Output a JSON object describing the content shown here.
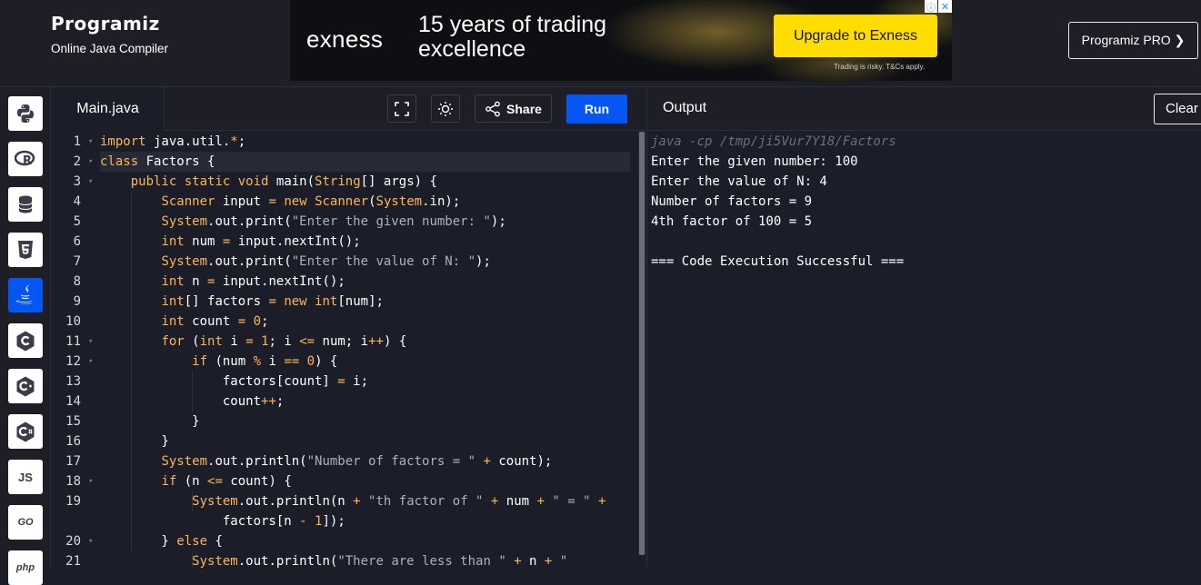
{
  "header": {
    "brand": "Programiz",
    "subtitle": "Online Java Compiler",
    "pro_button": "Programiz PRO ❯"
  },
  "ad": {
    "logo": "exness",
    "headline": "15 years of trading excellence",
    "cta": "Upgrade to Exness",
    "note": "Trading is risky. T&Cs apply.",
    "info_icon": "ⓘ",
    "close_icon": "✕"
  },
  "languages": [
    {
      "name": "Python",
      "icon": "python-icon"
    },
    {
      "name": "R",
      "icon": "r-icon"
    },
    {
      "name": "SQL",
      "icon": "database-icon"
    },
    {
      "name": "HTML",
      "icon": "html5-icon"
    },
    {
      "name": "Java",
      "icon": "java-icon",
      "active": true
    },
    {
      "name": "C",
      "icon": "c-icon"
    },
    {
      "name": "C++",
      "icon": "cpp-icon"
    },
    {
      "name": "C#",
      "icon": "csharp-icon"
    },
    {
      "name": "JS",
      "icon": "js-icon",
      "label": "JS"
    },
    {
      "name": "Go",
      "icon": "go-icon",
      "label": "GO"
    },
    {
      "name": "PHP",
      "icon": "php-icon",
      "label": "php"
    }
  ],
  "editor": {
    "tab": "Main.java",
    "share_label": "Share",
    "run_label": "Run",
    "line_numbers": [
      "1",
      "2",
      "3",
      "4",
      "5",
      "6",
      "7",
      "8",
      "9",
      "10",
      "11",
      "12",
      "13",
      "14",
      "15",
      "16",
      "17",
      "18",
      "19",
      "",
      "20",
      "21"
    ],
    "lines": [
      "import java.util.*;",
      "class Factors {",
      "    public static void main(String[] args) {",
      "        Scanner input = new Scanner(System.in);",
      "        System.out.print(\"Enter the given number: \");",
      "        int num = input.nextInt();",
      "        System.out.print(\"Enter the value of N: \");",
      "        int n = input.nextInt();",
      "        int[] factors = new int[num];",
      "        int count = 0;",
      "        for (int i = 1; i <= num; i++) {",
      "            if (num % i == 0) {",
      "                factors[count] = i;",
      "                count++;",
      "            }",
      "        }",
      "        System.out.println(\"Number of factors = \" + count);",
      "        if (n <= count) {",
      "            System.out.println(n + \"th factor of \" + num + \" = \" +",
      "                factors[n - 1]);",
      "        } else {",
      "            System.out.println(\"There are less than \" + n + \""
    ]
  },
  "output": {
    "title": "Output",
    "clear_label": "Clear",
    "lines": [
      "java -cp /tmp/ji5Vur7Y18/Factors",
      "Enter the given number: 100",
      "Enter the value of N: 4",
      "Number of factors = 9",
      "4th factor of 100 = 5",
      "",
      "=== Code Execution Successful ==="
    ]
  }
}
